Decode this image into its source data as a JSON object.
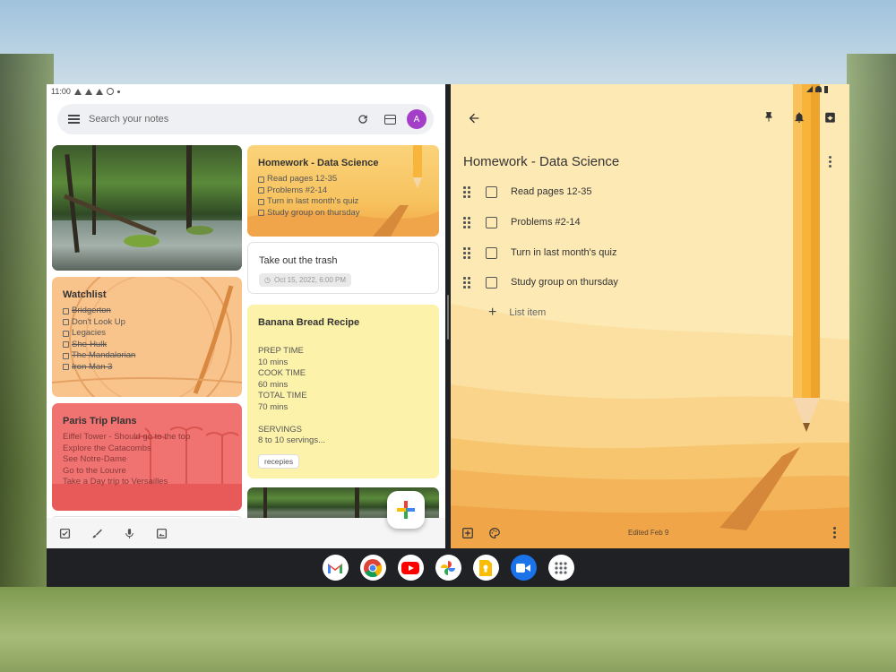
{
  "status_bar": {
    "time": "11:00"
  },
  "search": {
    "placeholder": "Search your notes",
    "avatar_letter": "A"
  },
  "notes": {
    "homework": {
      "title": "Homework - Data Science",
      "items": [
        "Read pages 12-35",
        "Problems #2-14",
        "Turn in last month's quiz",
        "Study group on thursday"
      ]
    },
    "watchlist": {
      "title": "Watchlist",
      "items": [
        "Bridgerton",
        "Don't Look Up",
        "Legacies",
        "She-Hulk",
        "The Mandalorian",
        "Iron Man 3"
      ]
    },
    "trash": {
      "title": "Take out the trash",
      "reminder": "Oct 15, 2022, 6:00 PM"
    },
    "paris": {
      "title": "Paris Trip Plans",
      "lines": [
        "Eiffel Tower - Should go to the top",
        "Explore the Catacombs",
        "See Notre-Dame",
        "Go to the Louvre",
        "Take a Day trip to Versailles"
      ]
    },
    "banana": {
      "title": "Banana Bread Recipe",
      "lines": [
        "PREP TIME",
        "10 mins",
        "COOK TIME",
        "60 mins",
        "TOTAL TIME",
        "70 mins",
        "",
        "SERVINGS",
        "8 to 10 servings..."
      ],
      "label": "recepies"
    }
  },
  "editor": {
    "title": "Homework - Data Science",
    "items": [
      "Read pages 12-35",
      "Problems #2-14",
      "Turn in last month's quiz",
      "Study group on thursday"
    ],
    "add_item": "List item",
    "edited": "Edited Feb 9"
  },
  "icons": {
    "menu": "hamburger-icon",
    "refresh": "refresh-icon",
    "view": "grid-view-icon",
    "back": "back-arrow-icon",
    "pin": "pin-icon",
    "reminder": "bell-icon",
    "archive": "archive-icon",
    "more": "more-vert-icon",
    "add_box": "add-box-icon",
    "palette": "palette-icon",
    "checkbox": "checkbox-icon",
    "brush": "brush-icon",
    "mic": "mic-icon",
    "image": "image-icon"
  },
  "colors": {
    "avatar": "#a43dc7",
    "homework": "#fbd37a",
    "watchlist": "#f9c38c",
    "paris": "#f07372",
    "banana": "#fdf2a9"
  },
  "shelf_apps": [
    "Gmail",
    "Chrome",
    "YouTube",
    "Photos",
    "Keep",
    "Meet",
    "Launcher"
  ]
}
